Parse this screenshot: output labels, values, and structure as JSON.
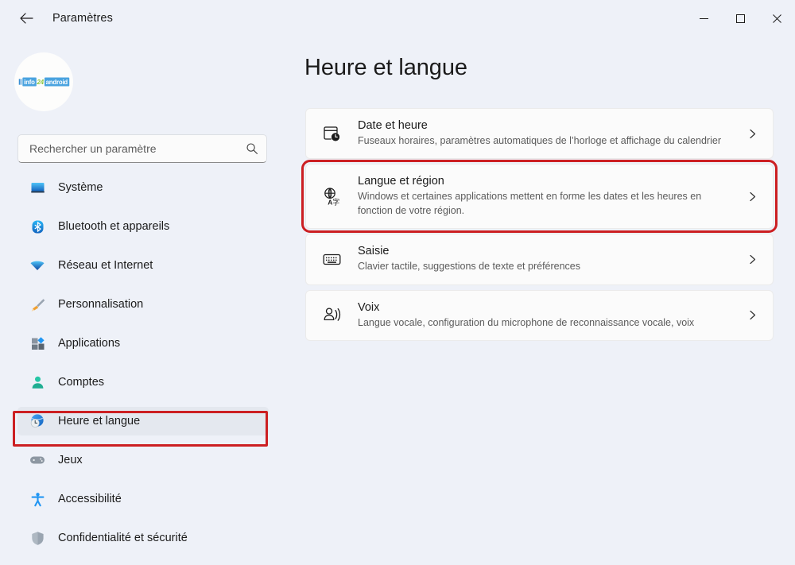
{
  "titlebar": {
    "back_label": "back-arrow",
    "app_title": "Paramètres",
    "minimize_label": "—",
    "maximize_label": "□",
    "close_label": "✕"
  },
  "sidebar": {
    "avatar": {
      "logo_info": "info",
      "logo_24": "24",
      "logo_android": "android"
    },
    "search": {
      "placeholder": "Rechercher un paramètre",
      "value": ""
    },
    "items": [
      {
        "label": "Système",
        "icon": "monitor-icon",
        "selected": false
      },
      {
        "label": "Bluetooth et appareils",
        "icon": "bluetooth-icon",
        "selected": false
      },
      {
        "label": "Réseau et Internet",
        "icon": "wifi-icon",
        "selected": false
      },
      {
        "label": "Personnalisation",
        "icon": "paintbrush-icon",
        "selected": false
      },
      {
        "label": "Applications",
        "icon": "apps-icon",
        "selected": false
      },
      {
        "label": "Comptes",
        "icon": "person-icon",
        "selected": false
      },
      {
        "label": "Heure et langue",
        "icon": "clock-globe-icon",
        "selected": true
      },
      {
        "label": "Jeux",
        "icon": "gamepad-icon",
        "selected": false
      },
      {
        "label": "Accessibilité",
        "icon": "accessibility-icon",
        "selected": false
      },
      {
        "label": "Confidentialité et sécurité",
        "icon": "shield-icon",
        "selected": false
      }
    ]
  },
  "main": {
    "page_title": "Heure et langue",
    "cards": [
      {
        "title": "Date et heure",
        "desc": "Fuseaux horaires, paramètres automatiques de l’horloge et affichage du calendrier",
        "icon": "calendar-clock-icon",
        "highlighted": false
      },
      {
        "title": "Langue et région",
        "desc": "Windows et certaines applications mettent en forme les dates et les heures en fonction de votre région.",
        "icon": "globe-language-icon",
        "highlighted": true
      },
      {
        "title": "Saisie",
        "desc": "Clavier tactile, suggestions de texte et préférences",
        "icon": "keyboard-icon",
        "highlighted": false
      },
      {
        "title": "Voix",
        "desc": "Langue vocale, configuration du microphone de reconnaissance vocale, voix",
        "icon": "speech-icon",
        "highlighted": false
      }
    ]
  },
  "colors": {
    "window_bg": "#eef1f8",
    "content_bg": "#f3f5f9",
    "card_bg": "#fbfbfb",
    "highlight_red": "#cc1f22",
    "accent_blue": "#0f4fc4",
    "text_primary": "#1b1b1b",
    "text_secondary": "#5b5b5b"
  }
}
